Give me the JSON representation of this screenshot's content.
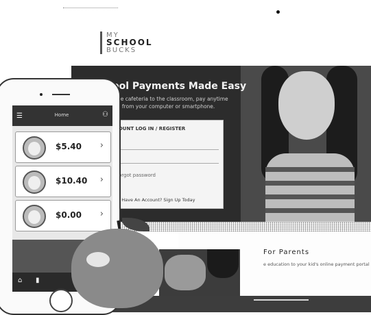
{
  "brand": {
    "my": "MY",
    "school": "SCHOOL",
    "bucks": "BUCKS"
  },
  "hero": {
    "title": "ool Payments Made Easy",
    "tagline_1": "the cafeteria to the classroom, pay anytime",
    "tagline_2": "re from your computer or smartphone."
  },
  "login": {
    "heading": "DUNT LOG IN / REGISTER",
    "field_1": "l",
    "field_2": "l",
    "link": "orgot password",
    "register": "| Have An Account? Sign Up Today"
  },
  "parents": {
    "title": "For Parents",
    "text": "e education to your kid's online payment portal"
  },
  "phone": {
    "header_title": "Home",
    "students": [
      {
        "amount": "$5.40"
      },
      {
        "amount": "$10.40"
      },
      {
        "amount": "$0.00"
      }
    ]
  }
}
